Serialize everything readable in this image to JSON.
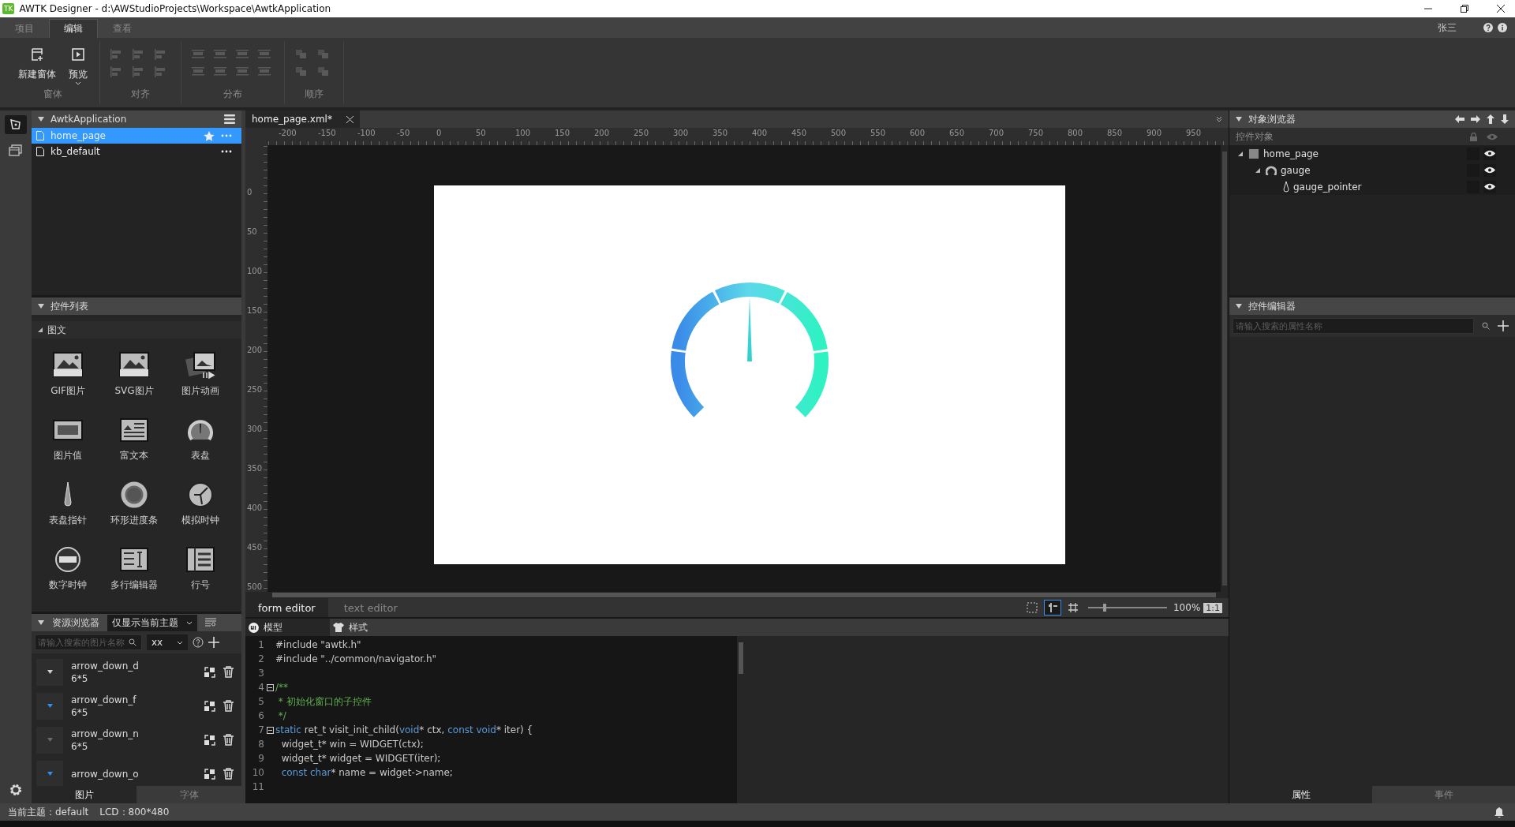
{
  "window": {
    "app_icon_text": "TK",
    "title": "AWTK Designer - d:\\AWStudioProjects\\Workspace\\AwtkApplication"
  },
  "ribbon": {
    "tabs": [
      {
        "label": "项目",
        "selected": false
      },
      {
        "label": "编辑",
        "selected": true
      },
      {
        "label": "查看",
        "selected": false
      }
    ],
    "user": "张三",
    "groups": [
      {
        "kind": "window",
        "label": "窗体",
        "tools": [
          {
            "label": "新建窗体",
            "disabled": false,
            "dropdown": false
          },
          {
            "label": "预览",
            "disabled": false,
            "dropdown": true
          }
        ]
      },
      {
        "kind": "align",
        "label": "对齐",
        "tools": [
          {
            "disabled": true
          },
          {
            "disabled": true
          },
          {
            "disabled": true
          },
          {
            "disabled": true
          },
          {
            "disabled": true
          },
          {
            "disabled": true
          }
        ]
      },
      {
        "kind": "distribute",
        "label": "分布",
        "tools": [
          {
            "disabled": true
          },
          {
            "disabled": true
          },
          {
            "disabled": true
          },
          {
            "disabled": true
          },
          {
            "disabled": true
          },
          {
            "disabled": true
          },
          {
            "disabled": true
          },
          {
            "disabled": true
          }
        ]
      },
      {
        "kind": "order",
        "label": "顺序",
        "tools": [
          {
            "disabled": true
          },
          {
            "disabled": true
          },
          {
            "disabled": true
          },
          {
            "disabled": true
          }
        ]
      }
    ]
  },
  "project": {
    "title": "AwtkApplication",
    "files": [
      {
        "name": "home_page",
        "selected": true,
        "starred": true
      },
      {
        "name": "kb_default",
        "selected": false,
        "starred": false
      }
    ]
  },
  "widget_list": {
    "title": "控件列表",
    "section": "图文",
    "section_expanded": true,
    "items": [
      {
        "label": "GIF图片",
        "kind": "image"
      },
      {
        "label": "SVG图片",
        "kind": "image"
      },
      {
        "label": "图片动画",
        "kind": "animation"
      },
      {
        "label": "图片值",
        "kind": "digits"
      },
      {
        "label": "富文本",
        "kind": "richtext"
      },
      {
        "label": "表盘",
        "kind": "gauge"
      },
      {
        "label": "表盘指针",
        "kind": "needle"
      },
      {
        "label": "环形进度条",
        "kind": "ring"
      },
      {
        "label": "模拟时钟",
        "kind": "clock"
      },
      {
        "label": "数字时钟",
        "kind": "digitalclock"
      },
      {
        "label": "多行编辑器",
        "kind": "text"
      },
      {
        "label": "行号",
        "kind": "list"
      }
    ]
  },
  "resources": {
    "title": "资源浏览器",
    "filter": "仅显示当前主题",
    "search_placeholder": "请输入搜索的图片名称",
    "theme": "xx",
    "items": [
      {
        "name": "arrow_down_d",
        "size": "6*5",
        "color": "#d0d0d0"
      },
      {
        "name": "arrow_down_f",
        "size": "6*5",
        "color": "#2f8ff0"
      },
      {
        "name": "arrow_down_n",
        "size": "6*5",
        "color": "#6a6a6a"
      },
      {
        "name": "arrow_down_o",
        "color": "#2f8ff0"
      }
    ],
    "tabs": [
      {
        "label": "图片",
        "selected": true
      },
      {
        "label": "字体",
        "selected": false
      }
    ]
  },
  "editor": {
    "file_tab": "home_page.xml*",
    "h_ruler": [
      "-200",
      "-150",
      "-100",
      "-50",
      "0",
      "50",
      "100",
      "150",
      "200",
      "250",
      "300",
      "350",
      "400",
      "450",
      "500",
      "550",
      "600",
      "650",
      "700",
      "750",
      "800",
      "850",
      "900",
      "950"
    ],
    "v_ruler": [
      "0",
      "50",
      "100",
      "150",
      "200",
      "250",
      "300",
      "350",
      "400",
      "450",
      "500"
    ],
    "modes": [
      {
        "label": "form editor",
        "selected": true
      },
      {
        "label": "text editor",
        "selected": false
      }
    ],
    "tools": [
      {
        "kind": "select",
        "selected": false
      },
      {
        "kind": "guides",
        "selected": true
      },
      {
        "kind": "grid",
        "selected": false
      }
    ],
    "zoom": {
      "level": 0.2,
      "reading": "100%",
      "reset": "1:1"
    },
    "code_tabs": [
      {
        "label": "模型",
        "kind": "model"
      },
      {
        "label": "样式",
        "kind": "style"
      }
    ],
    "code": [
      {
        "n": "1",
        "parts": [
          {
            "t": "#include \"awtk.h\"",
            "kind": "plain"
          }
        ]
      },
      {
        "n": "2",
        "parts": [
          {
            "t": "#include \"../common/navigator.h\"",
            "kind": "plain"
          }
        ]
      },
      {
        "n": "3"
      },
      {
        "n": "4",
        "folded": false,
        "parts": [
          {
            "t": "/**",
            "kind": "comment"
          }
        ]
      },
      {
        "n": "5",
        "parts": [
          {
            "t": " * 初始化窗口的子控件",
            "kind": "comment"
          }
        ]
      },
      {
        "n": "6",
        "parts": [
          {
            "t": " */",
            "kind": "comment"
          }
        ]
      },
      {
        "n": "7",
        "folded": false,
        "parts": [
          {
            "t": "static",
            "kind": "keyword"
          },
          {
            "t": " ret_t visit_init_child(",
            "kind": "plain"
          },
          {
            "t": "void",
            "kind": "keyword"
          },
          {
            "t": "* ctx, ",
            "kind": "plain"
          },
          {
            "t": "const void",
            "kind": "keyword"
          },
          {
            "t": "* iter) {",
            "kind": "plain"
          }
        ]
      },
      {
        "n": "8",
        "parts": [
          {
            "t": "  widget_t* win = WIDGET(ctx);",
            "kind": "plain"
          }
        ]
      },
      {
        "n": "9",
        "parts": [
          {
            "t": "  widget_t* widget = WIDGET(iter);",
            "kind": "plain"
          }
        ]
      },
      {
        "n": "10",
        "parts": [
          {
            "t": "  const char",
            "kind": "keyword"
          },
          {
            "t": "* name = widget->name;",
            "kind": "plain"
          }
        ]
      },
      {
        "n": "11"
      }
    ]
  },
  "object_browser": {
    "title": "对象浏览器",
    "column": "控件对象",
    "tree": [
      {
        "name": "home_page",
        "kind": "window",
        "expanded": true,
        "visible": true,
        "children": [
          {
            "name": "gauge",
            "kind": "gauge",
            "expanded": true,
            "visible": true,
            "children": [
              {
                "name": "gauge_pointer",
                "kind": "pointer",
                "visible": true
              }
            ]
          }
        ]
      }
    ]
  },
  "widget_editor": {
    "title": "控件编辑器",
    "search_placeholder": "请输入搜索的属性名称",
    "tabs": [
      {
        "label": "属性",
        "selected": true
      },
      {
        "label": "事件",
        "selected": false
      }
    ]
  },
  "status_bar": {
    "theme": "当前主题：default",
    "lcd": "LCD：800*480"
  }
}
